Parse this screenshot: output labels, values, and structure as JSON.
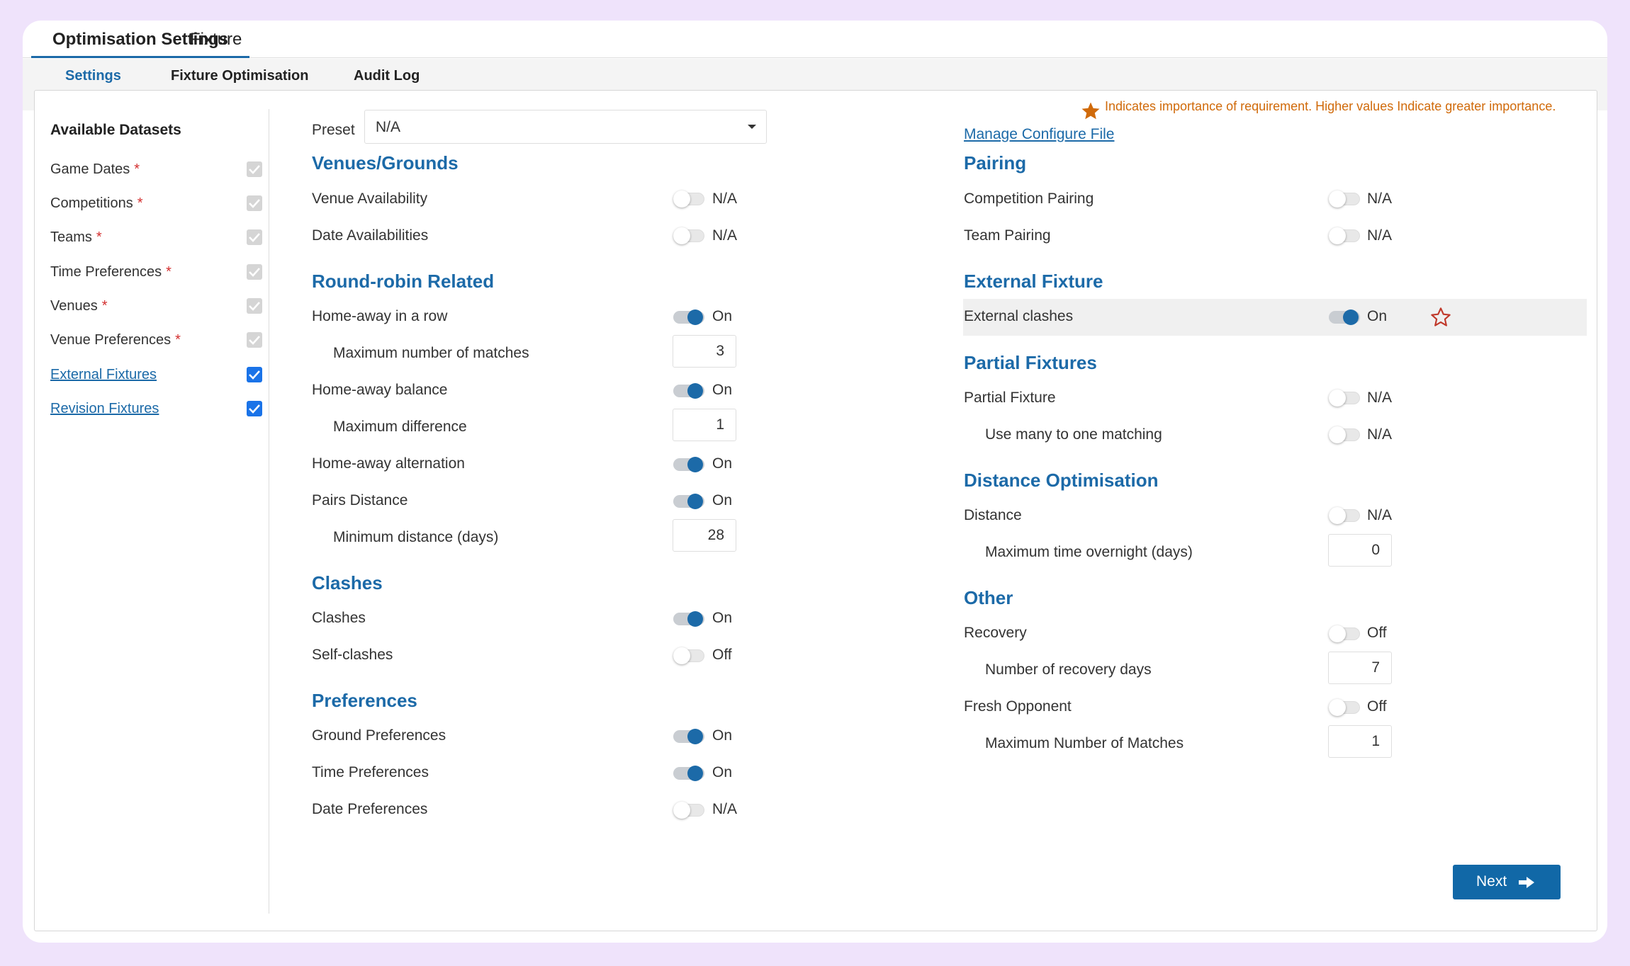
{
  "main_tabs": [
    {
      "label": "Optimisation Settings",
      "active": true
    },
    {
      "label": "Fixture",
      "active": false
    }
  ],
  "sub_tabs": [
    {
      "label": "Settings",
      "active": true
    },
    {
      "label": "Fixture Optimisation",
      "active": false
    },
    {
      "label": "Audit Log",
      "active": false
    }
  ],
  "sidebar": {
    "title": "Available Datasets",
    "items": [
      {
        "label": "Game Dates",
        "required": "*",
        "checked": true,
        "disabled": true
      },
      {
        "label": "Competitions",
        "required": "*",
        "checked": true,
        "disabled": true
      },
      {
        "label": "Teams",
        "required": "*",
        "checked": true,
        "disabled": true
      },
      {
        "label": "Time Preferences",
        "required": "*",
        "checked": true,
        "disabled": true
      },
      {
        "label": "Venues",
        "required": "*",
        "checked": true,
        "disabled": true
      },
      {
        "label": "Venue Preferences",
        "required": "*",
        "checked": true,
        "disabled": true
      },
      {
        "label": "External Fixtures",
        "required": "",
        "checked": true,
        "disabled": false
      },
      {
        "label": "Revision Fixtures",
        "required": "",
        "checked": true,
        "disabled": false
      }
    ]
  },
  "preset": {
    "label": "Preset",
    "value": "N/A"
  },
  "importance_note": "Indicates importance of requirement. Higher values Indicate greater importance.",
  "manage_link": "Manage Configure File",
  "left": {
    "venues": {
      "title": "Venues/Grounds",
      "venue_availability": {
        "label": "Venue Availability",
        "state": "N/A"
      },
      "date_availabilities": {
        "label": "Date Availabilities",
        "state": "N/A"
      }
    },
    "round_robin": {
      "title": "Round-robin Related",
      "home_away_row": {
        "label": "Home-away in a row",
        "state": "On"
      },
      "max_matches": {
        "label": "Maximum number of matches",
        "value": "3"
      },
      "home_away_balance": {
        "label": "Home-away balance",
        "state": "On"
      },
      "max_difference": {
        "label": "Maximum difference",
        "value": "1"
      },
      "home_away_alternation": {
        "label": "Home-away alternation",
        "state": "On"
      },
      "pairs_distance": {
        "label": "Pairs Distance",
        "state": "On"
      },
      "min_distance": {
        "label": "Minimum distance (days)",
        "value": "28"
      }
    },
    "clashes": {
      "title": "Clashes",
      "clashes": {
        "label": "Clashes",
        "state": "On"
      },
      "self_clashes": {
        "label": "Self-clashes",
        "state": "Off"
      }
    },
    "preferences": {
      "title": "Preferences",
      "ground": {
        "label": "Ground Preferences",
        "state": "On"
      },
      "time": {
        "label": "Time Preferences",
        "state": "On"
      },
      "date": {
        "label": "Date Preferences",
        "state": "N/A"
      }
    }
  },
  "right": {
    "pairing": {
      "title": "Pairing",
      "competition": {
        "label": "Competition Pairing",
        "state": "N/A"
      },
      "team": {
        "label": "Team Pairing",
        "state": "N/A"
      }
    },
    "external": {
      "title": "External Fixture",
      "clashes": {
        "label": "External clashes",
        "state": "On"
      }
    },
    "partial": {
      "title": "Partial Fixtures",
      "partial_fixture": {
        "label": "Partial Fixture",
        "state": "N/A"
      },
      "many_to_one": {
        "label": "Use many to one matching",
        "state": "N/A"
      }
    },
    "distance": {
      "title": "Distance Optimisation",
      "distance": {
        "label": "Distance",
        "state": "N/A"
      },
      "max_overnight": {
        "label": "Maximum time overnight (days)",
        "value": "0"
      }
    },
    "other": {
      "title": "Other",
      "recovery": {
        "label": "Recovery",
        "state": "Off"
      },
      "recovery_days": {
        "label": "Number of recovery days",
        "value": "7"
      },
      "fresh_opponent": {
        "label": "Fresh Opponent",
        "state": "Off"
      },
      "max_number_matches": {
        "label": "Maximum Number of Matches",
        "value": "1"
      }
    }
  },
  "next_button": "Next",
  "colors": {
    "accent": "#1c6aa8",
    "note": "#d06a0a",
    "required": "#d32f2f",
    "background": "#efe3fb"
  }
}
